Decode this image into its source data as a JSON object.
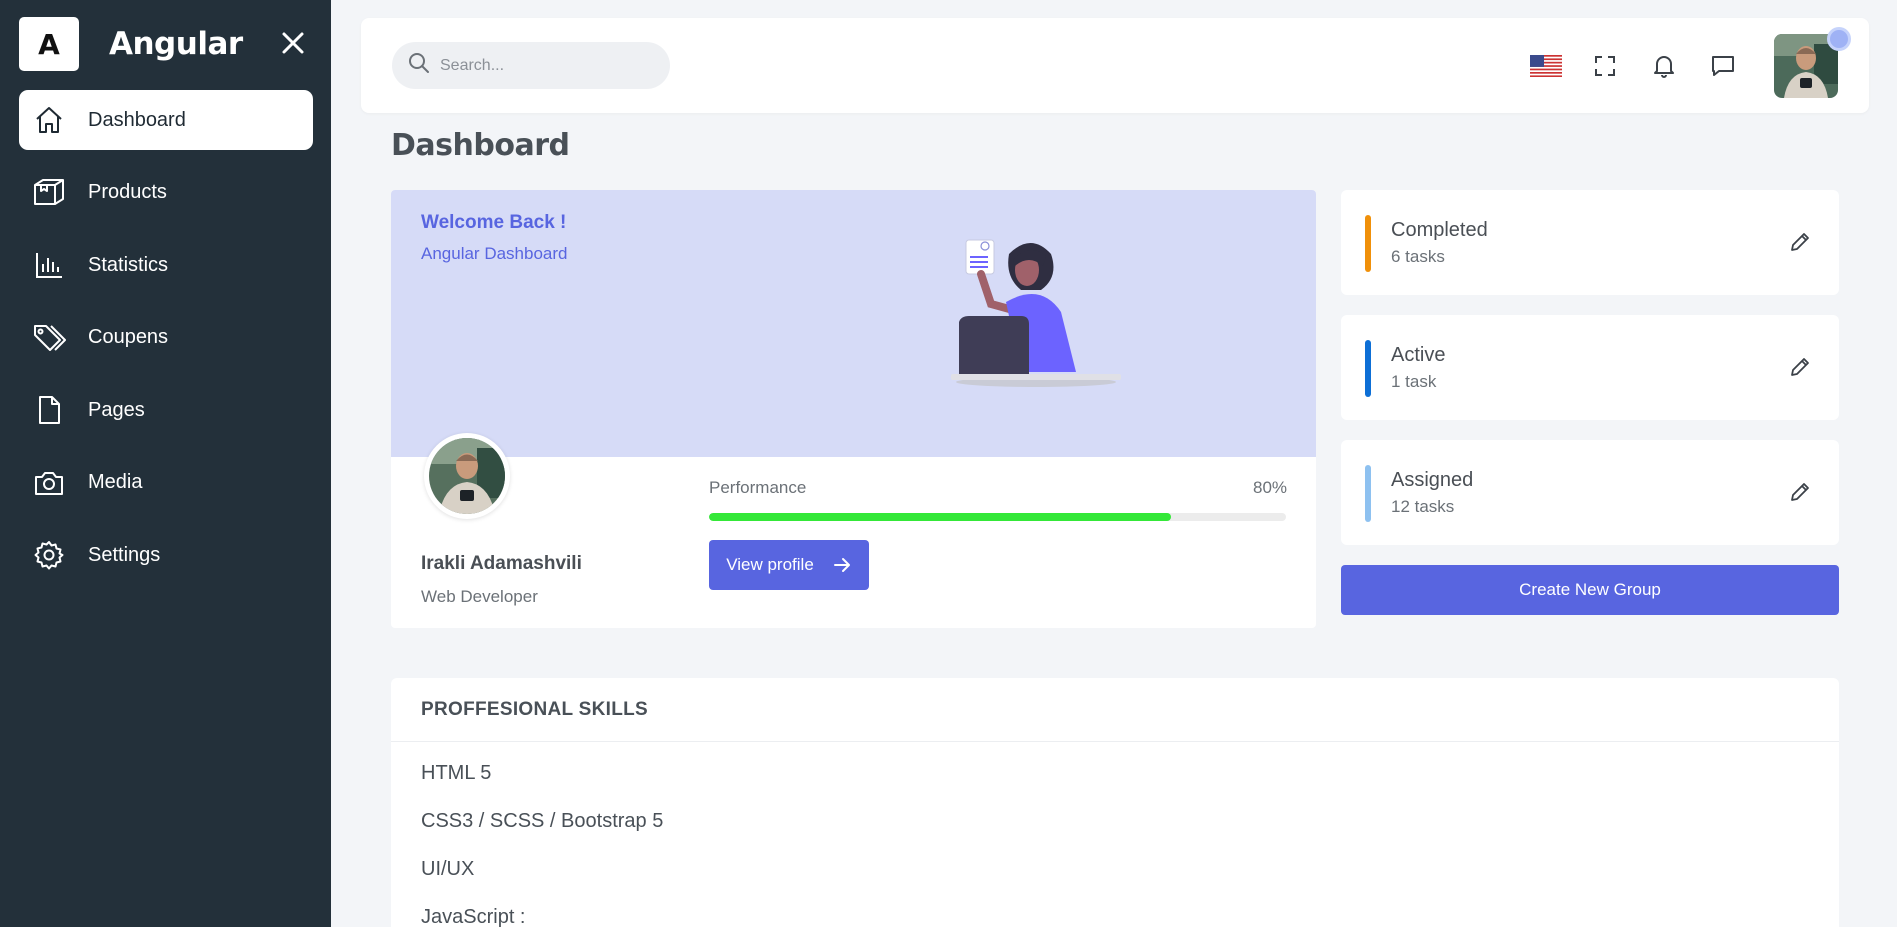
{
  "brand": {
    "logo_letter": "A",
    "name": "Angular"
  },
  "sidebar": {
    "items": [
      {
        "label": "Dashboard",
        "icon": "home-icon",
        "active": true
      },
      {
        "label": "Products",
        "icon": "box-icon"
      },
      {
        "label": "Statistics",
        "icon": "bar-chart-icon"
      },
      {
        "label": "Coupens",
        "icon": "tags-icon"
      },
      {
        "label": "Pages",
        "icon": "file-icon"
      },
      {
        "label": "Media",
        "icon": "camera-icon"
      },
      {
        "label": "Settings",
        "icon": "gear-icon"
      }
    ]
  },
  "header": {
    "search_placeholder": "Search...",
    "icons": [
      "us-flag-icon",
      "fullscreen-icon",
      "bell-icon",
      "chat-icon"
    ]
  },
  "page_title": "Dashboard",
  "welcome": {
    "title": "Welcome Back !",
    "subtitle": "Angular Dashboard",
    "name": "Irakli Adamashvili",
    "role": "Web Developer",
    "performance_label": "Performance",
    "performance_value": "80%",
    "performance_fraction": 0.8,
    "view_profile_label": "View profile"
  },
  "tasks": [
    {
      "title": "Completed",
      "count": "6 tasks",
      "color": "#f0900a"
    },
    {
      "title": "Active",
      "count": "1 task",
      "color": "#0d6fd6"
    },
    {
      "title": "Assigned",
      "count": "12 tasks",
      "color": "#8ec1f0"
    }
  ],
  "create_group_label": "Create New Group",
  "skills": {
    "title": "PROFFESIONAL SKILLS",
    "items": [
      "HTML 5",
      "CSS3 / SCSS / Bootstrap 5",
      "UI/UX",
      "JavaScript :"
    ]
  },
  "colors": {
    "sidebar_bg": "#23303a",
    "accent": "#5865e0",
    "progress": "#34e838",
    "welcome_bg": "#d6dbf7"
  }
}
